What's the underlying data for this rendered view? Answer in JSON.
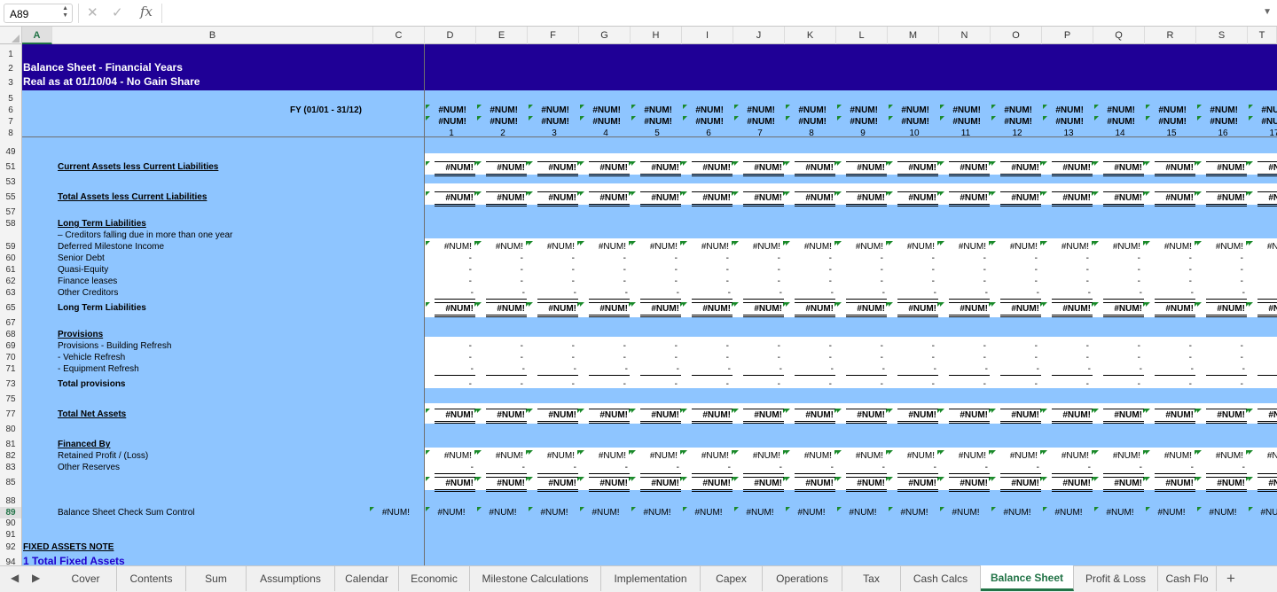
{
  "formula_bar": {
    "name_box": "A89",
    "fx_label": "fx",
    "formula": ""
  },
  "columns": [
    "A",
    "B",
    "C",
    "D",
    "E",
    "F",
    "G",
    "H",
    "I",
    "J",
    "K",
    "L",
    "M",
    "N",
    "O",
    "P",
    "Q",
    "R",
    "S",
    "T"
  ],
  "selected_column": "A",
  "selected_row": "89",
  "header": {
    "title": "Balance Sheet - Financial Years",
    "subtitle": "Real as at 01/10/04 - No Gain Share",
    "fy_label": "FY  (01/01 -  31/12)"
  },
  "num_error": "#NUM!",
  "period_numbers": [
    "1",
    "2",
    "3",
    "4",
    "5",
    "6",
    "7",
    "8",
    "9",
    "10",
    "11",
    "12",
    "13",
    "14",
    "15",
    "16",
    "17"
  ],
  "rows": [
    {
      "row": "1"
    },
    {
      "row": "2"
    },
    {
      "row": "3"
    },
    {
      "row": "5"
    },
    {
      "row": "6"
    },
    {
      "row": "7"
    },
    {
      "row": "8"
    },
    {
      "row": "49"
    },
    {
      "row": "51",
      "label": "Current Assets less Current Liabilities",
      "style": "bu",
      "values": "num-ul"
    },
    {
      "row": "53"
    },
    {
      "row": "55",
      "label": "Total Assets less Current Liabilities",
      "style": "bu",
      "values": "num-ul"
    },
    {
      "row": "57"
    },
    {
      "row": "58",
      "label": "Long Term Liabilities",
      "style": "bu"
    },
    {
      "row": "58b",
      "label": "– Creditors falling due in more than one year"
    },
    {
      "row": "59",
      "label": "Deferred Milestone Income",
      "values": "num"
    },
    {
      "row": "60",
      "label": "Senior Debt",
      "values": "dash"
    },
    {
      "row": "61",
      "label": "Quasi-Equity",
      "values": "dash"
    },
    {
      "row": "62",
      "label": "Finance leases",
      "values": "dash"
    },
    {
      "row": "63",
      "label": "Other Creditors",
      "values": "dash"
    },
    {
      "row": "65",
      "label": "Long Term Liabilities",
      "style": "b",
      "values": "num-ul"
    },
    {
      "row": "67"
    },
    {
      "row": "68",
      "label": "Provisions",
      "style": "bu"
    },
    {
      "row": "69",
      "label": "Provisions - Building Refresh",
      "values": "dash"
    },
    {
      "row": "70",
      "label": "- Vehicle Refresh",
      "values": "dash"
    },
    {
      "row": "71",
      "label": "- Equipment Refresh",
      "values": "dash"
    },
    {
      "row": "73",
      "label": "Total provisions",
      "style": "b",
      "values": "dash"
    },
    {
      "row": "75"
    },
    {
      "row": "77",
      "label": "Total Net Assets",
      "style": "bu",
      "values": "num-ul"
    },
    {
      "row": "80"
    },
    {
      "row": "81",
      "label": "Financed By",
      "style": "bu"
    },
    {
      "row": "82",
      "label": "Retained Profit / (Loss)",
      "values": "num"
    },
    {
      "row": "83",
      "label": "Other Reserves",
      "values": "dash"
    },
    {
      "row": "85",
      "values": "num-ul"
    },
    {
      "row": "88"
    },
    {
      "row": "89",
      "label": "Balance Sheet Check Sum Control",
      "values": "num-c"
    },
    {
      "row": "90"
    },
    {
      "row": "91"
    },
    {
      "row": "92",
      "label": "FIXED ASSETS NOTE"
    },
    {
      "row": "94",
      "label": "1 Total Fixed Assets"
    }
  ],
  "tabs": [
    "Cover",
    "Contents",
    "Sum",
    "Assumptions",
    "Calendar",
    "Economic",
    "Milestone Calculations",
    "Implementation",
    "Capex",
    "Operations",
    "Tax",
    "Cash Calcs",
    "Balance Sheet",
    "Profit & Loss",
    "Cash Flo"
  ],
  "active_tab": "Balance Sheet",
  "colors": {
    "header_band": "#1f0096",
    "fill": "#8ec5ff",
    "accent": "#217346",
    "error_flag": "#1a8a2a",
    "fixed_assets_link": "#1f00cc"
  }
}
